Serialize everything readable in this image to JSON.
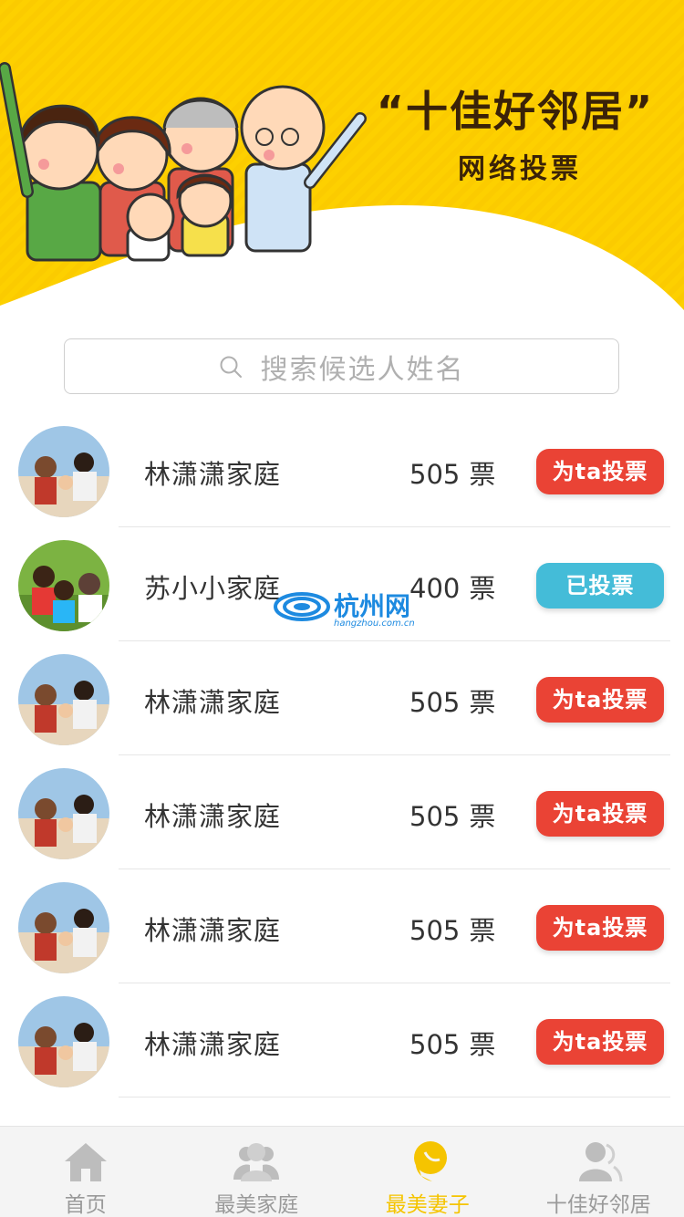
{
  "banner": {
    "title": "“十佳好邻居”",
    "subtitle": "网络投票"
  },
  "search": {
    "placeholder": "搜索候选人姓名"
  },
  "candidates": [
    {
      "name": "林潇潇家庭",
      "votes": "505",
      "unit": "票",
      "button": "为ta投票",
      "voted": false
    },
    {
      "name": "苏小小家庭",
      "votes": "400",
      "unit": "票",
      "button": "已投票",
      "voted": true
    },
    {
      "name": "林潇潇家庭",
      "votes": "505",
      "unit": "票",
      "button": "为ta投票",
      "voted": false
    },
    {
      "name": "林潇潇家庭",
      "votes": "505",
      "unit": "票",
      "button": "为ta投票",
      "voted": false
    },
    {
      "name": "林潇潇家庭",
      "votes": "505",
      "unit": "票",
      "button": "为ta投票",
      "voted": false
    },
    {
      "name": "林潇潇家庭",
      "votes": "505",
      "unit": "票",
      "button": "为ta投票",
      "voted": false
    }
  ],
  "watermark": {
    "text": "杭州网",
    "sub": "hangzhou.com.cn"
  },
  "tabs": [
    {
      "label": "首页",
      "icon": "home-icon",
      "active": false
    },
    {
      "label": "最美家庭",
      "icon": "group-icon",
      "active": false
    },
    {
      "label": "最美妻子",
      "icon": "woman-icon",
      "active": true
    },
    {
      "label": "十佳好邻居",
      "icon": "neighbors-icon",
      "active": false
    }
  ],
  "colors": {
    "banner_yellow": "#fdd000",
    "vote_red": "#ea4335",
    "voted_blue": "#44bcd8",
    "tab_active": "#f5c400",
    "tab_inactive": "#9a9a9a"
  }
}
